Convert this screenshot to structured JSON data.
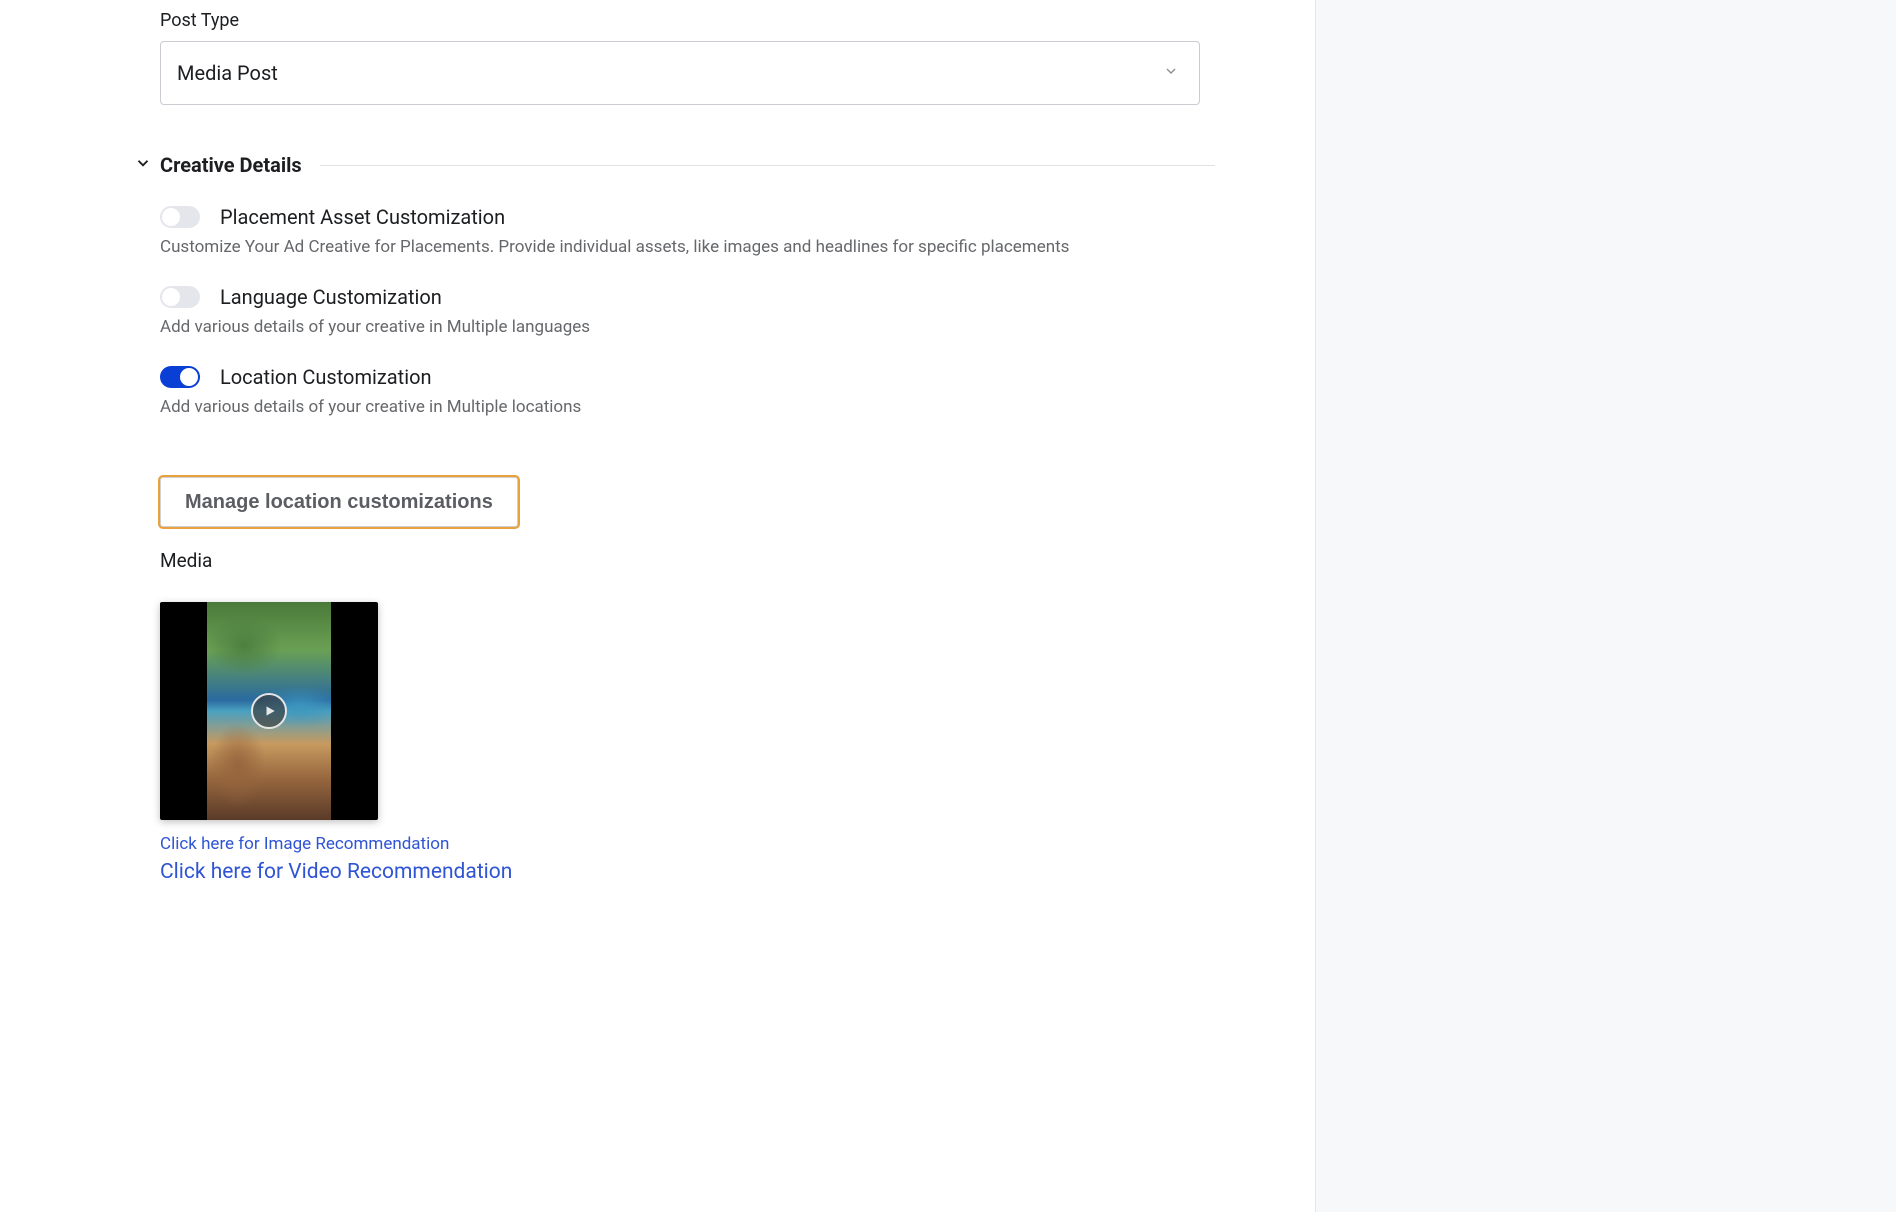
{
  "post_type": {
    "label": "Post Type",
    "value": "Media Post"
  },
  "creative_details": {
    "title": "Creative Details",
    "items": [
      {
        "enabled": false,
        "label": "Placement Asset Customization",
        "desc": "Customize Your Ad Creative for Placements. Provide individual assets, like images and headlines for specific placements"
      },
      {
        "enabled": false,
        "label": "Language Customization",
        "desc": "Add various details of your creative in Multiple languages"
      },
      {
        "enabled": true,
        "label": "Location Customization",
        "desc": "Add various details of your creative in Multiple locations"
      }
    ]
  },
  "manage_button": "Manage location customizations",
  "media": {
    "label": "Media",
    "links": {
      "image_rec": "Click here for Image Recommendation",
      "video_rec": "Click here for Video Recommendation"
    }
  }
}
